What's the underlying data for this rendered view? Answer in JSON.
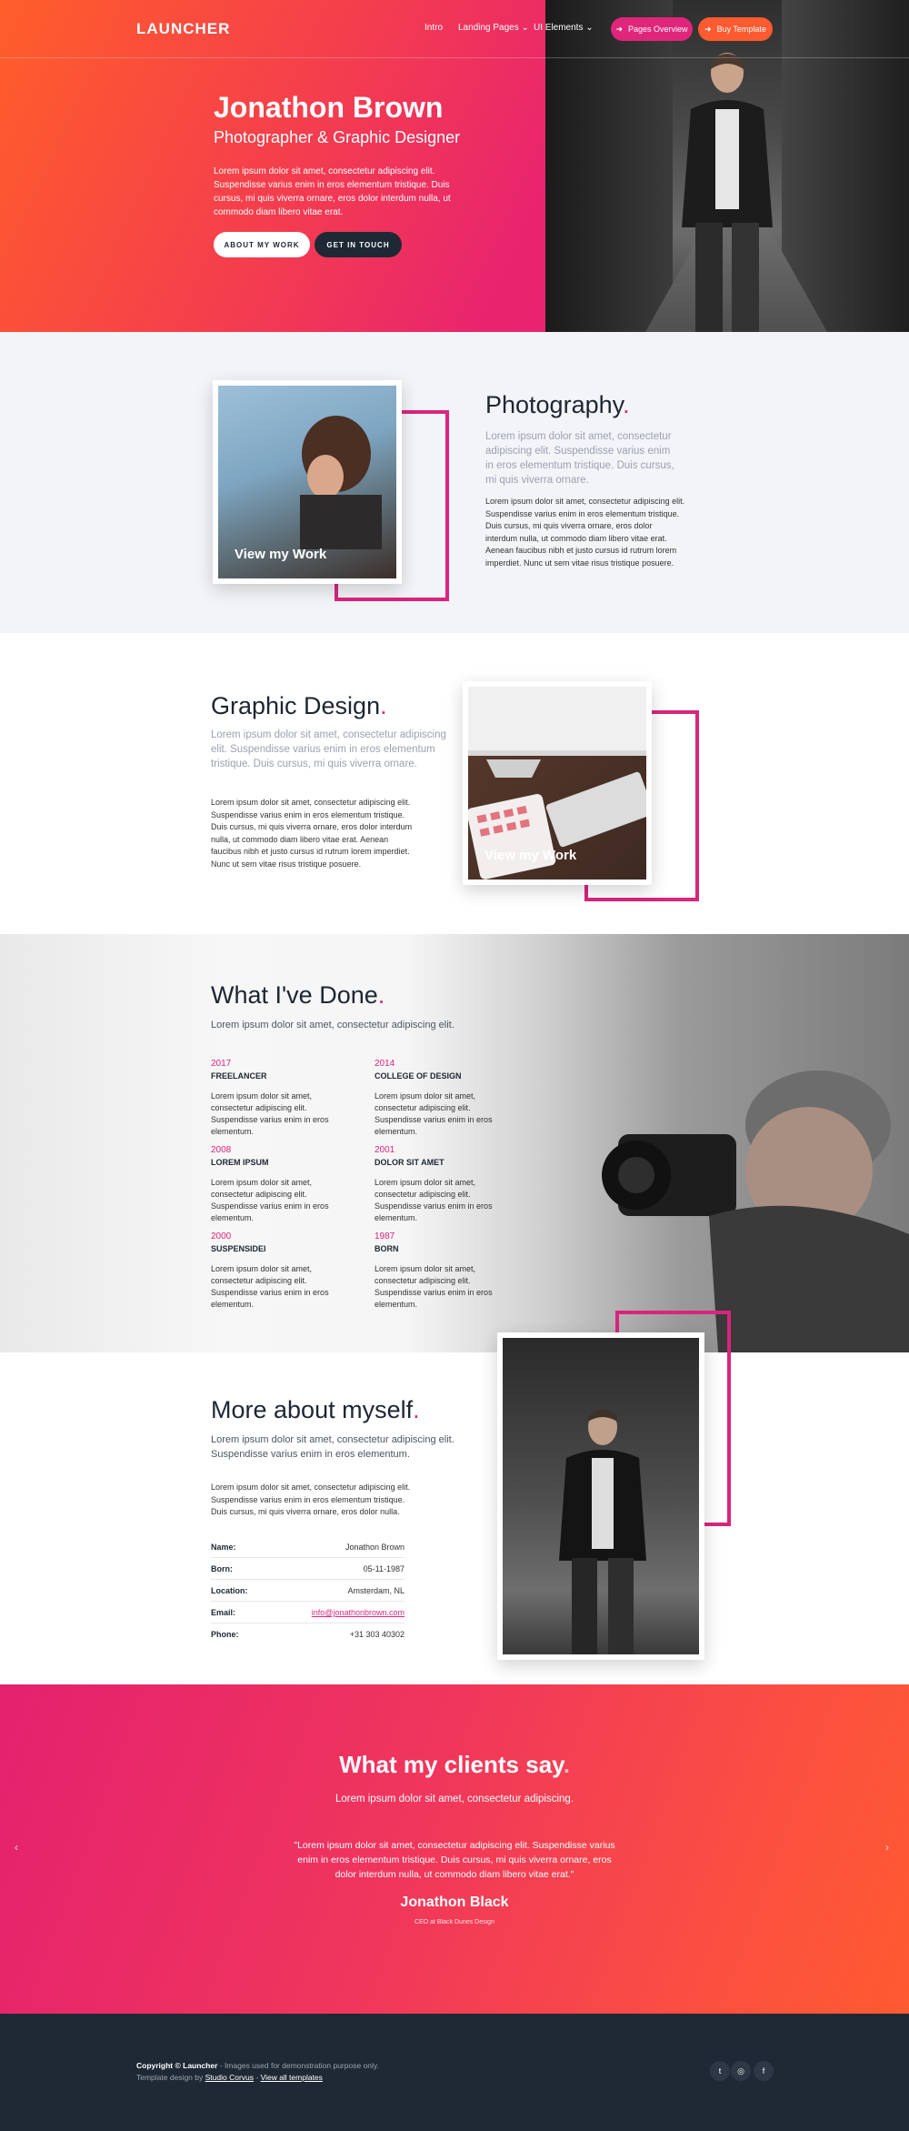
{
  "nav": {
    "logo": "LAUNCHER",
    "links": [
      "Intro",
      "Landing Pages",
      "UI Elements"
    ],
    "pages_overview": "Pages Overview",
    "buy_template": "Buy Template"
  },
  "hero": {
    "name": "Jonathon Brown",
    "role": "Photographer & Graphic Designer",
    "text": "Lorem ipsum dolor sit amet, consectetur adipiscing elit. Suspendisse varius enim in eros elementum tristique. Duis cursus, mi quis viverra ornare, eros dolor interdum nulla, ut commodo diam libero vitae erat.",
    "about_btn": "ABOUT MY WORK",
    "contact_btn": "GET IN TOUCH"
  },
  "photography": {
    "title": "Photography",
    "lead": "Lorem ipsum dolor sit amet, consectetur adipiscing elit. Suspendisse varius enim in eros elementum tristique. Duis cursus, mi quis viverra ornare.",
    "body": "Lorem ipsum dolor sit amet, consectetur adipiscing elit. Suspendisse varius enim in eros elementum tristique. Duis cursus, mi quis viverra ornare, eros dolor interdum nulla, ut commodo diam libero vitae erat. Aenean faucibus nibh et justo cursus id rutrum lorem imperdiet. Nunc ut sem vitae risus tristique posuere.",
    "view": "View my Work"
  },
  "design": {
    "title": "Graphic Design",
    "lead": "Lorem ipsum dolor sit amet, consectetur adipiscing elit. Suspendisse varius enim in eros elementum tristique. Duis cursus, mi quis viverra ornare.",
    "body": "Lorem ipsum dolor sit amet, consectetur adipiscing elit. Suspendisse varius enim in eros elementum tristique. Duis cursus, mi quis viverra ornare, eros dolor interdum nulla, ut commodo diam libero vitae erat. Aenean faucibus nibh et justo cursus id rutrum lorem imperdiet. Nunc ut sem vitae risus tristique posuere.",
    "view": "View my Work"
  },
  "done": {
    "title": "What I've Done",
    "lead": "Lorem ipsum dolor sit amet, consectetur adipiscing elit.",
    "items": [
      {
        "year": "2017",
        "title": "FREELANCER",
        "text": "Lorem ipsum dolor sit amet, consectetur adipiscing elit. Suspendisse varius enim in eros elementum."
      },
      {
        "year": "2014",
        "title": "COLLEGE OF DESIGN",
        "text": "Lorem ipsum dolor sit amet, consectetur adipiscing elit. Suspendisse varius enim in eros elementum."
      },
      {
        "year": "2008",
        "title": "LOREM IPSUM",
        "text": "Lorem ipsum dolor sit amet, consectetur adipiscing elit. Suspendisse varius enim in eros elementum."
      },
      {
        "year": "2001",
        "title": "DOLOR SIT AMET",
        "text": "Lorem ipsum dolor sit amet, consectetur adipiscing elit. Suspendisse varius enim in eros elementum."
      },
      {
        "year": "2000",
        "title": "SUSPENSIDEI",
        "text": "Lorem ipsum dolor sit amet, consectetur adipiscing elit. Suspendisse varius enim in eros elementum."
      },
      {
        "year": "1987",
        "title": "BORN",
        "text": "Lorem ipsum dolor sit amet, consectetur adipiscing elit. Suspendisse varius enim in eros elementum."
      }
    ]
  },
  "about": {
    "title": "More about myself",
    "lead": "Lorem ipsum dolor sit amet, consectetur adipiscing elit. Suspendisse varius enim in eros elementum.",
    "body": "Lorem ipsum dolor sit amet, consectetur adipiscing elit. Suspendisse varius enim in eros elementum tristique. Duis cursus, mi quis viverra ornare, eros dolor nulla.",
    "rows": [
      {
        "k": "Name:",
        "v": "Jonathon Brown"
      },
      {
        "k": "Born:",
        "v": "05-11-1987"
      },
      {
        "k": "Location:",
        "v": "Amsterdam, NL"
      },
      {
        "k": "Email:",
        "v": "info@jonathonbrown.com"
      },
      {
        "k": "Phone:",
        "v": "+31 303 40302"
      }
    ]
  },
  "testimonial": {
    "title": "What my clients say",
    "lead": "Lorem ipsum dolor sit amet, consectetur adipiscing.",
    "quote": "\"Lorem ipsum dolor sit amet, consectetur adipiscing elit. Suspendisse varius enim in eros elementum tristique. Duis cursus, mi quis viverra ornare, eros dolor interdum nulla, ut commodo diam libero vitae erat.\"",
    "author": "Jonathon Black",
    "author_role": "CEO at Black Dunes Design"
  },
  "footer": {
    "copyright_bold": "Copyright © Launcher",
    "copyright_rest": " - Images used for demonstration purpose only.",
    "design_by": "Template design by ",
    "studio": "Studio Corvus",
    "sep": " - ",
    "view_all": "View all templates"
  },
  "colors": {
    "accent": "#e0267b",
    "orange": "#ff5a30",
    "dark": "#1e2935"
  }
}
